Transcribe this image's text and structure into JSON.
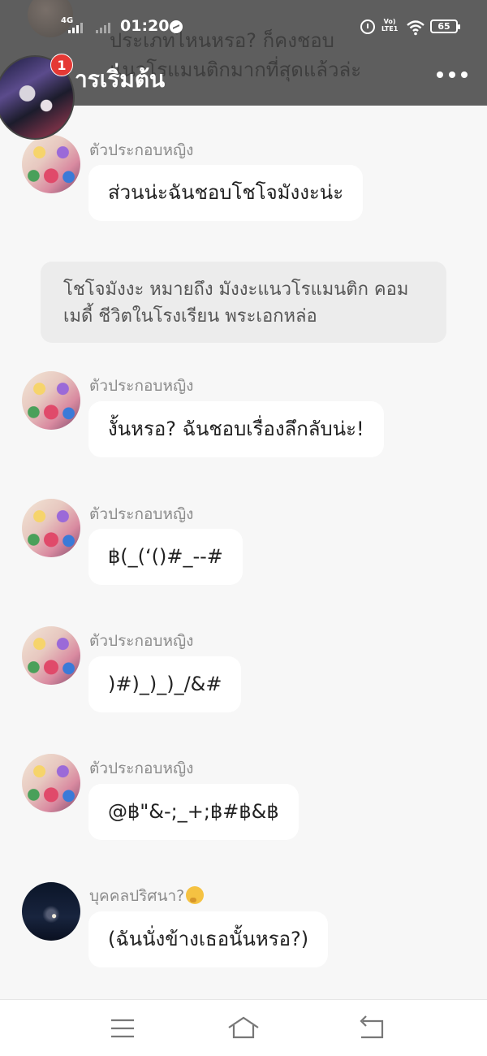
{
  "status_bar": {
    "network": "4G",
    "time": "01:20",
    "volte": [
      "Vo)",
      "LTE1"
    ],
    "battery": "65"
  },
  "header": {
    "title": "ารเริ่มต้น",
    "notification_count": "1",
    "ghost_text": [
      "ประเภทไหนหรอ? ก็คงชอบ",
      "แนวโรแมนติกมากที่สุดแล้วล่ะ"
    ]
  },
  "messages": [
    {
      "speaker": "ตัวประกอบหญิง",
      "text": "ส่วนน่ะฉันชอบโชโจมังงะน่ะ"
    },
    {
      "narration": "โชโจมังงะ หมายถึง มังงะแนวโรแมนติก คอมเมดี้ ชีวิตในโรงเรียน พระเอกหล่อ"
    },
    {
      "speaker": "ตัวประกอบหญิง",
      "text": "งั้นหรอ? ฉันชอบเรื่องลึกลับน่ะ!"
    },
    {
      "speaker": "ตัวประกอบหญิง",
      "text": "฿(_(‘()#_--#"
    },
    {
      "speaker": "ตัวประกอบหญิง",
      "text": ")#)_)_)_/&#"
    },
    {
      "speaker": "ตัวประกอบหญิง",
      "text": "@฿\"&-;_+;฿#฿&฿"
    },
    {
      "speaker": "บุคคลปริศนา?",
      "speaker_emoji": "thinking-face",
      "text": "(ฉันนั่งข้างเธอนั้นหรอ?)"
    }
  ],
  "nav_bar": {
    "icons": [
      "menu-icon",
      "home-icon",
      "back-icon"
    ]
  }
}
